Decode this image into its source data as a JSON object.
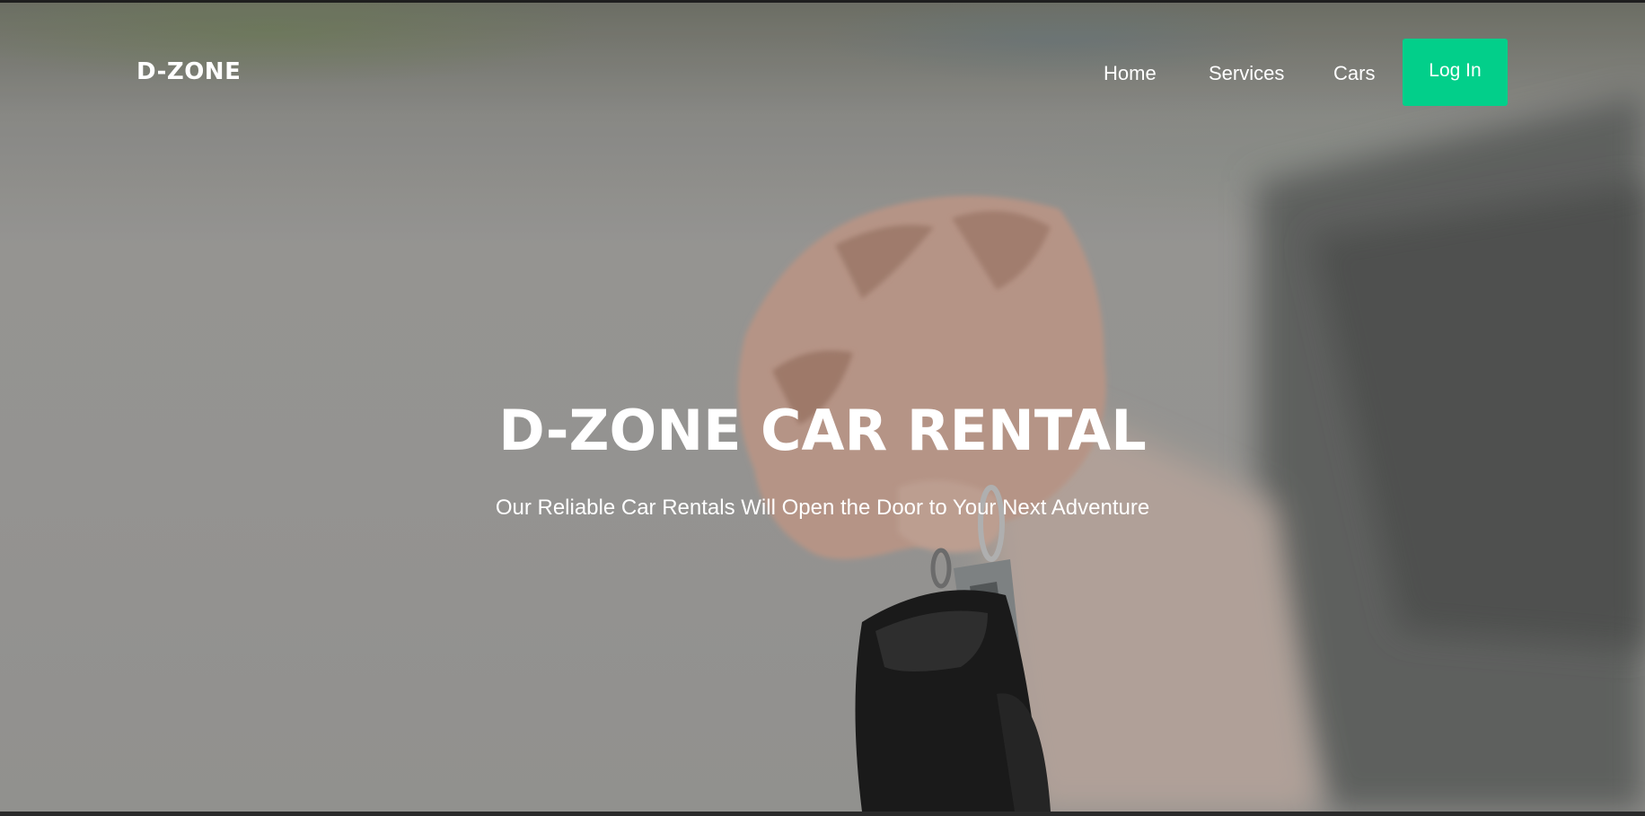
{
  "brand": {
    "logo_text": "D-ZONE",
    "accent_color": "#02cf8a"
  },
  "nav": {
    "items": [
      {
        "label": "Home"
      },
      {
        "label": "Services"
      },
      {
        "label": "Cars"
      }
    ],
    "login_label": "Log In"
  },
  "hero": {
    "title": "D-ZONE CAR RENTAL",
    "subtitle": "Our Reliable Car Rentals Will Open the Door to Your Next Adventure",
    "image_description_icon": "hand-holding-car-key-photo"
  }
}
